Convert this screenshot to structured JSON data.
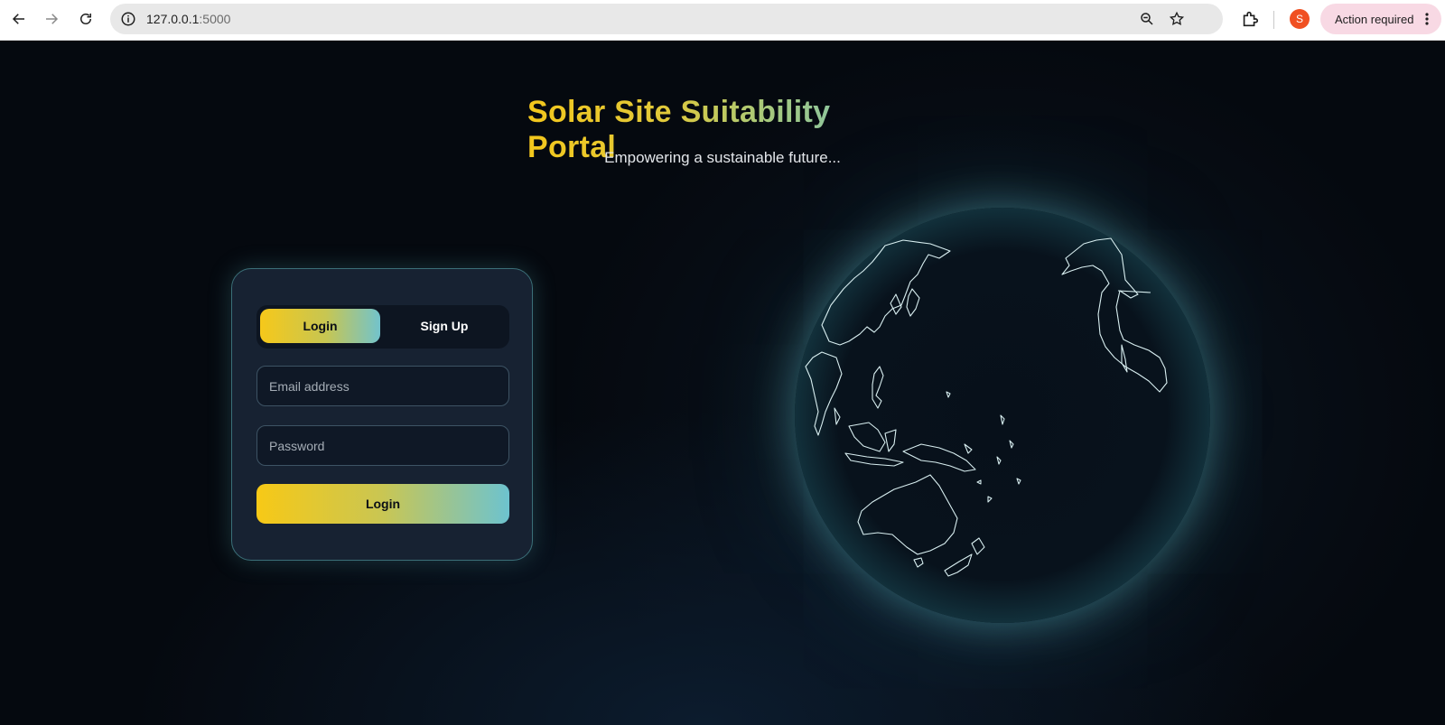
{
  "browser": {
    "url_host": "127.0.0.1",
    "url_port": ":5000",
    "avatar_letter": "S",
    "action_label": "Action required"
  },
  "hero": {
    "title": "Solar Site Suitability Portal",
    "subtitle": "Empowering a sustainable future..."
  },
  "auth": {
    "tabs": [
      {
        "label": "Login",
        "active": true
      },
      {
        "label": "Sign Up",
        "active": false
      }
    ],
    "email_placeholder": "Email address",
    "password_placeholder": "Password",
    "submit_label": "Login"
  },
  "colors": {
    "accent_gold": "#f6c81a",
    "accent_teal": "#6dc3cf",
    "card_bg": "#172232",
    "page_bg": "#05090f"
  }
}
